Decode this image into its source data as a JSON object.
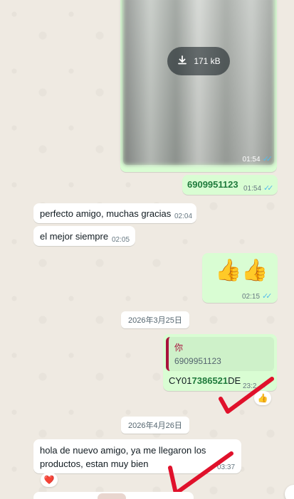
{
  "media_message": {
    "size_label": "171 kB",
    "time": "01:54"
  },
  "messages": {
    "tracking_out": {
      "text": "6909951123",
      "time": "01:54"
    },
    "thanks_in": {
      "text": "perfecto amigo, muchas gracias",
      "time": "02:04"
    },
    "best_in": {
      "text": "el mejor siempre",
      "time": "02:05"
    },
    "emoji_out": {
      "text": "👍👍",
      "time": "02:15"
    },
    "reply_out": {
      "quote_author": "你",
      "quote_text": "6909951123",
      "text_prefix": "CY01",
      "text_highlight": "7386521",
      "text_suffix": "DE",
      "time": "23:2",
      "reaction": "👍"
    },
    "final_in": {
      "text": "hola de nuevo amigo, ya me llegaron los productos, estan muy bien",
      "time": "03:37",
      "reaction": "❤️"
    }
  },
  "date_chips": {
    "first": "2026年3月25日",
    "second": "2026年4月26日"
  },
  "colors": {
    "outgoing_bubble": "#d9fdd3",
    "incoming_bubble": "#ffffff",
    "read_ticks": "#53bdeb",
    "link_green": "#1f7a3c",
    "annotation_red": "#e0112b"
  }
}
